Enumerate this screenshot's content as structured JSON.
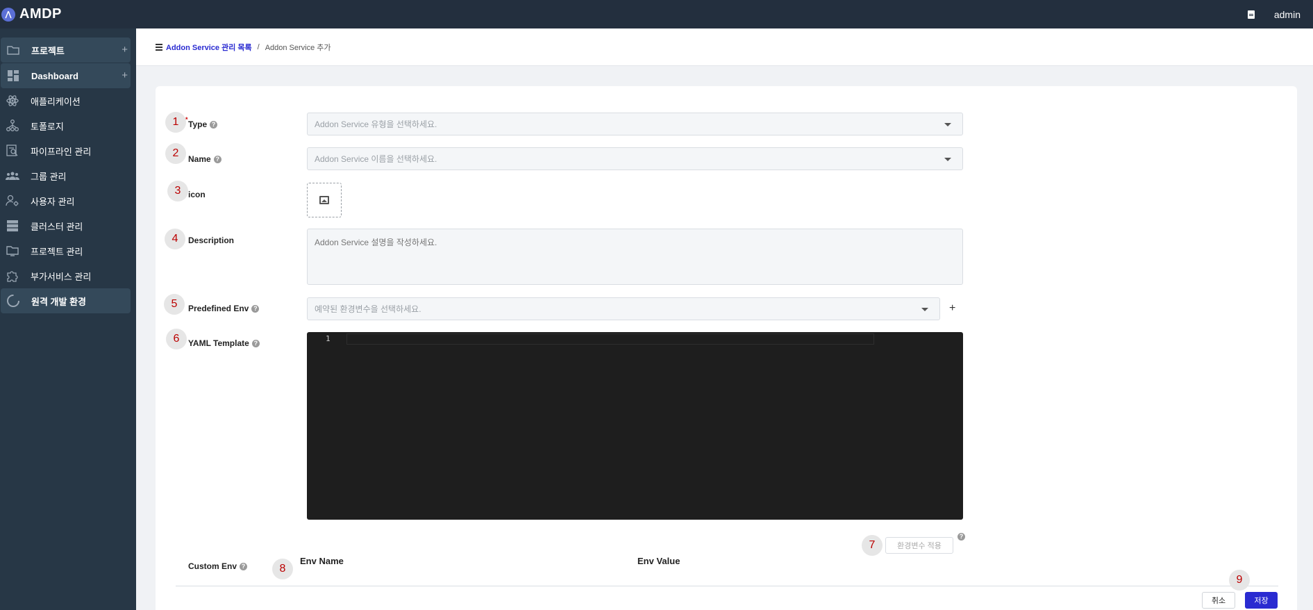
{
  "app": {
    "name": "AMDP",
    "user": "admin"
  },
  "sidebar": {
    "items": [
      {
        "label": "프로젝트",
        "icon": "folder-icon",
        "plus": "+"
      },
      {
        "label": "Dashboard",
        "icon": "dashboard-icon",
        "plus": "+"
      },
      {
        "label": "애플리케이션",
        "icon": "atom-icon"
      },
      {
        "label": "토폴로지",
        "icon": "topology-icon"
      },
      {
        "label": "파이프라인 관리",
        "icon": "pipeline-icon"
      },
      {
        "label": "그룹 관리",
        "icon": "group-icon"
      },
      {
        "label": "사용자 관리",
        "icon": "user-settings-icon"
      },
      {
        "label": "클러스터 관리",
        "icon": "server-icon"
      },
      {
        "label": "프로젝트 관리",
        "icon": "monitor-icon"
      },
      {
        "label": "부가서비스 관리",
        "icon": "puzzle-icon"
      },
      {
        "label": "원격 개발 환경",
        "icon": "spinner-icon"
      }
    ]
  },
  "breadcrumb": {
    "parent": "Addon Service 관리 목록",
    "separator": "/",
    "current": "Addon Service 추가"
  },
  "form": {
    "type": {
      "label": "Type",
      "placeholder": "Addon Service 유형을 선택하세요.",
      "number": "1"
    },
    "name": {
      "label": "Name",
      "placeholder": "Addon Service 이름을 선택하세요.",
      "number": "2"
    },
    "icon": {
      "label": "icon",
      "number": "3"
    },
    "description": {
      "label": "Description",
      "placeholder": "Addon Service 설명을 작성하세요.",
      "number": "4"
    },
    "predefined_env": {
      "label": "Predefined Env",
      "placeholder": "예약된 환경변수을 선택하세요.",
      "number": "5",
      "add": "+"
    },
    "yaml_template": {
      "label": "YAML Template",
      "number": "6",
      "line_number": "1"
    },
    "apply_env": {
      "label": "환경변수 적용",
      "number": "7"
    },
    "custom_env": {
      "label": "Custom Env",
      "number": "8",
      "col_name": "Env Name",
      "col_value": "Env Value"
    },
    "actions": {
      "cancel": "취소",
      "save": "저장",
      "number": "9"
    }
  },
  "help_glyph": "?"
}
